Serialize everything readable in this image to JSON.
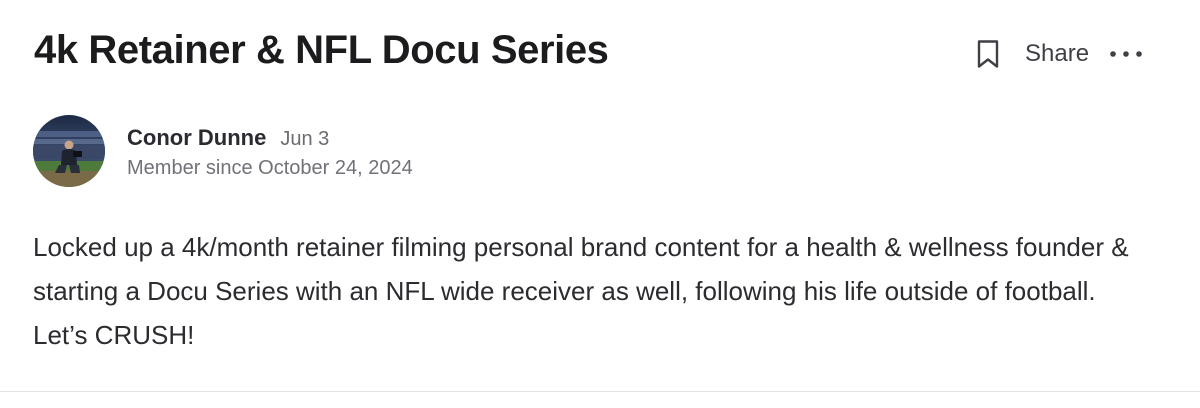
{
  "post": {
    "title": "4k Retainer & NFL Docu Series",
    "body": "Locked up a 4k/month retainer filming personal brand content for a health & wellness founder & starting a Docu Series with an NFL wide receiver as well, following his life outside of football. Let’s CRUSH!"
  },
  "actions": {
    "bookmark_icon": "bookmark-icon",
    "share_label": "Share",
    "more_icon": "more-horizontal-icon"
  },
  "author": {
    "name": "Conor Dunne",
    "post_date": "Jun 3",
    "member_since": "Member since October 24, 2024",
    "avatar_icon": "avatar"
  },
  "colors": {
    "title": "#1c1c1f",
    "text": "#2b2b30",
    "muted": "#71717a",
    "divider": "#e4e4e7"
  }
}
